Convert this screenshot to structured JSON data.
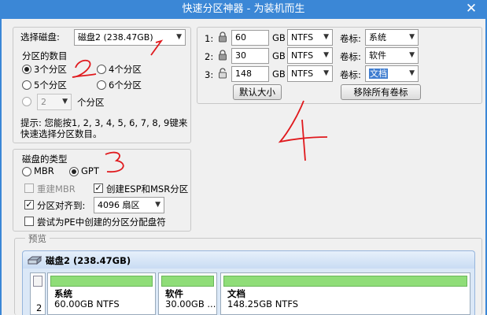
{
  "window": {
    "title": "快速分区神器 - 为装机而生",
    "close_glyph": "✕"
  },
  "disk_select": {
    "label": "选择磁盘:",
    "value": "磁盘2 (238.47GB)"
  },
  "partition_count": {
    "label": "分区的数目",
    "opt3": "3个分区",
    "opt4": "4个分区",
    "opt5": "5个分区",
    "opt6": "6个分区",
    "custom_value": "2",
    "custom_suffix": "个分区",
    "selected": "3个分区"
  },
  "hint": {
    "line1": "提示: 您能按1, 2, 3, 4, 5, 6, 7, 8, 9键来",
    "line2": "快速选择分区数目。"
  },
  "disk_type": {
    "label": "磁盘的类型",
    "mbr": "MBR",
    "gpt": "GPT",
    "selected": "GPT",
    "rebuild_mbr": "重建MBR",
    "create_esp": "创建ESP和MSR分区",
    "align_label": "分区对齐到:",
    "align_value": "4096 扇区",
    "pe_alloc": "尝试为PE中创建的分区分配盘符"
  },
  "partitions": [
    {
      "index": "1:",
      "size": "60",
      "unit": "GB",
      "fs": "NTFS",
      "vol_label": "卷标:",
      "name": "系统",
      "locked": true
    },
    {
      "index": "2:",
      "size": "30",
      "unit": "GB",
      "fs": "NTFS",
      "vol_label": "卷标:",
      "name": "软件",
      "locked": true
    },
    {
      "index": "3:",
      "size": "148",
      "unit": "GB",
      "fs": "NTFS",
      "vol_label": "卷标:",
      "name": "文档",
      "locked": false
    }
  ],
  "buttons": {
    "default_size": "默认大小",
    "remove_labels": "移除所有卷标"
  },
  "preview": {
    "legend": "预览",
    "disk_title": "磁盘2 (238.47GB)",
    "row_index": "2",
    "parts": [
      {
        "name": "系统",
        "info": "60.00GB NTFS"
      },
      {
        "name": "软件",
        "info": "30.00GB ..."
      },
      {
        "name": "文档",
        "info": "148.25GB NTFS"
      }
    ]
  },
  "annotations": {
    "n1": "1",
    "n2": "2",
    "n3": "3",
    "n4": "4",
    "color": "#e0191d"
  }
}
